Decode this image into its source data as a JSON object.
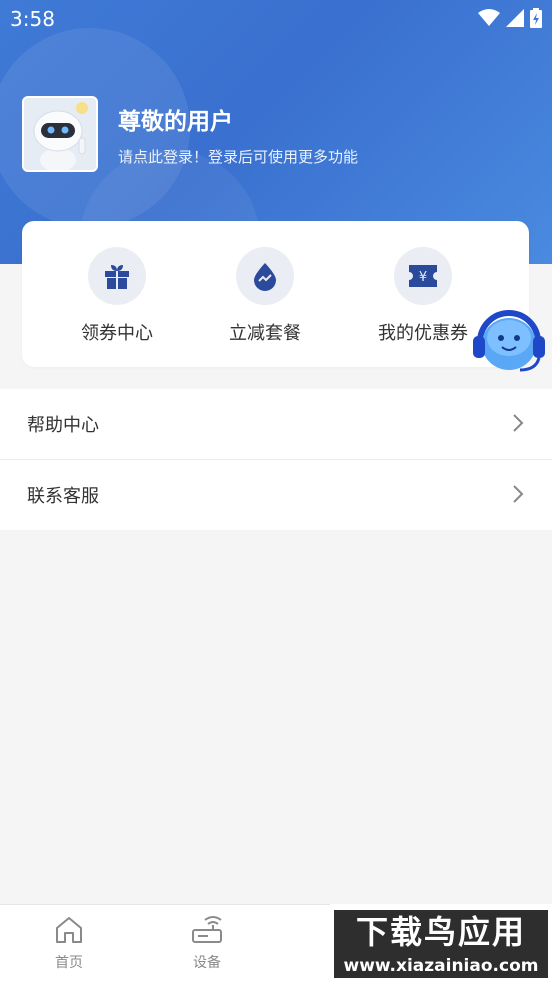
{
  "status_bar": {
    "time": "3:58"
  },
  "user": {
    "name": "尊敬的用户",
    "login_tip": "请点此登录！登录后可使用更多功能"
  },
  "quick_actions": [
    {
      "label": "领券中心",
      "icon": "gift-icon"
    },
    {
      "label": "立减套餐",
      "icon": "trend-drop-icon"
    },
    {
      "label": "我的优惠券",
      "icon": "ticket-yen-icon"
    }
  ],
  "menu": [
    {
      "label": "帮助中心"
    },
    {
      "label": "联系客服"
    }
  ],
  "tabbar": [
    {
      "label": "首页",
      "icon": "home-icon"
    },
    {
      "label": "设备",
      "icon": "router-icon"
    }
  ],
  "watermark": {
    "line1": "下载鸟应用",
    "line2": "www.xiazainiao.com"
  },
  "colors": {
    "header": "#3f7ad6",
    "accent": "#2b4a9c",
    "icon_bg": "#eaedf3"
  }
}
